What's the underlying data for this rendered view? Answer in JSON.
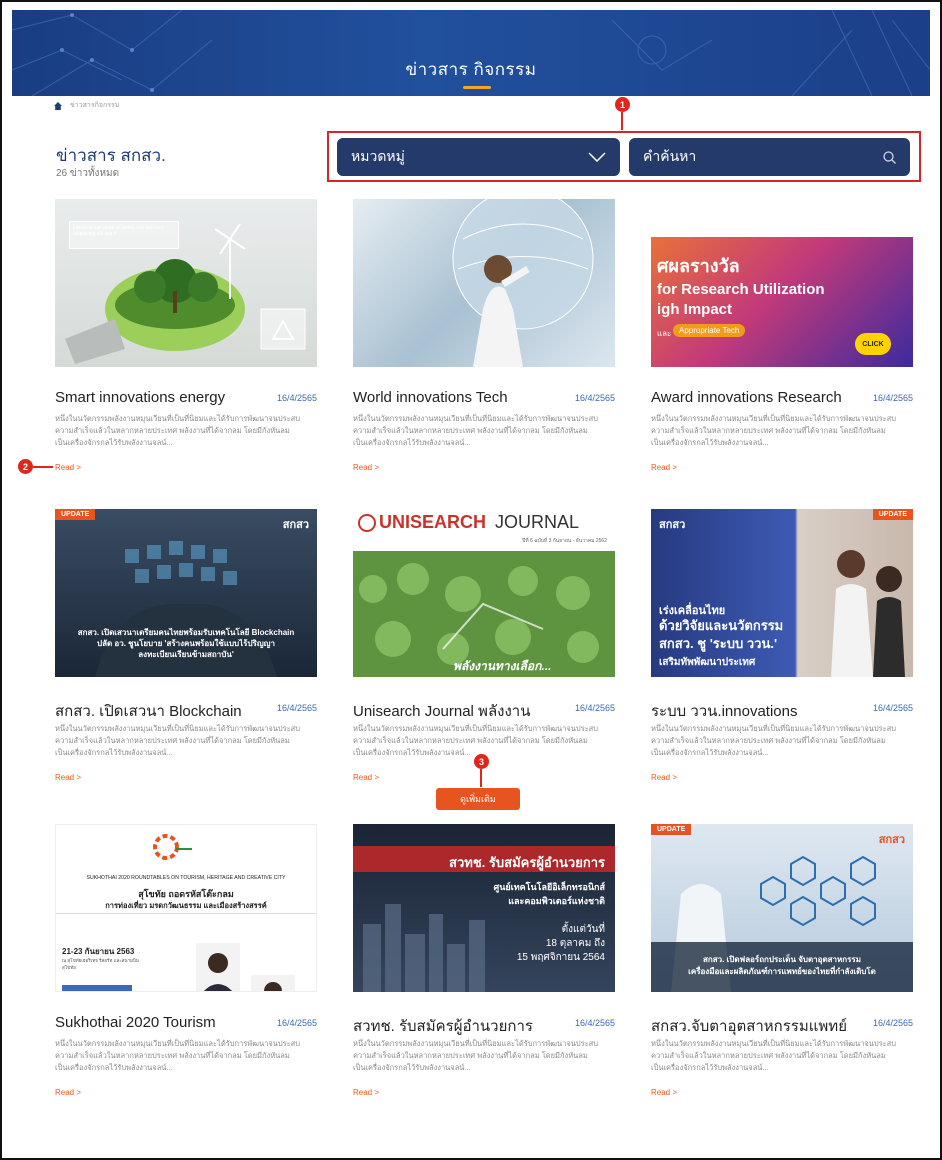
{
  "header": {
    "title": "ข่าวสาร กิจกรรม"
  },
  "breadcrumb": {
    "current": "ข่าวสารกิจกรรม"
  },
  "list": {
    "title": "ข่าวสาร สกสว.",
    "count": "26 ข่าวทั้งหมด"
  },
  "filters": {
    "category_label": "หมวดหมู่",
    "search_placeholder": "คำค้นหา"
  },
  "markers": {
    "m1": "1",
    "m2": "2",
    "m3": "3"
  },
  "cards": [
    {
      "title": "Smart innovations energy",
      "date": "16/4/2565",
      "desc1": "หนึ่งในนวัตกรรมพลังงานหมุนเวียนที่เป็นที่นิยมและได้รับการพัฒนาจนประสบ",
      "desc2": "ความสำเร็จแล้วในหลากหลายประเทศ พลังงานที่ได้จากลม โดยมีกังหันลม",
      "desc3": "เป็นเครื่องจักรกลไว้รับพลังงานจลน์...",
      "read": "Read >",
      "thumb_text": "Lorem ipsum dolor sit amet, con sectetur adipiscing elit sed d"
    },
    {
      "title": "World innovations Tech",
      "date": "16/4/2565",
      "desc1": "หนึ่งในนวัตกรรมพลังงานหมุนเวียนที่เป็นที่นิยมและได้รับการพัฒนาจนประสบ",
      "desc2": "ความสำเร็จแล้วในหลากหลายประเทศ พลังงานที่ได้จากลม โดยมีกังหันลม",
      "desc3": "เป็นเครื่องจักรกลไว้รับพลังงานจลน์...",
      "read": "Read >"
    },
    {
      "title": "Award innovations Research",
      "date": "16/4/2565",
      "desc1": "หนึ่งในนวัตกรรมพลังงานหมุนเวียนที่เป็นที่นิยมและได้รับการพัฒนาจนประสบ",
      "desc2": "ความสำเร็จแล้วในหลากหลายประเทศ พลังงานที่ได้จากลม โดยมีกังหันลม",
      "desc3": "เป็นเครื่องจักรกลไว้รับพลังงานจลน์...",
      "read": "Read >",
      "thumb_l1": "ศผลรางวัล",
      "thumb_l2": "for Research Utilization",
      "thumb_l3": "igh Impact",
      "thumb_l4": "และ",
      "thumb_pill": "Appropriate Tech",
      "thumb_click": "CLICK"
    },
    {
      "title": "สกสว. เปิดเสวนา Blockchain",
      "date": "16/4/2565",
      "desc1": "หนึ่งในนวัตกรรมพลังงานหมุนเวียนที่เป็นที่นิยมและได้รับการพัฒนาจนประสบ",
      "desc2": "ความสำเร็จแล้วในหลากหลายประเทศ พลังงานที่ได้จากลม โดยมีกังหันลม",
      "desc3": "เป็นเครื่องจักรกลไว้รับพลังงานจลน์...",
      "read": "Read >",
      "badge": "UPDATE",
      "logo": "สกสว",
      "thumb_l1": "สกสว. เปิดเสวนาเตรียมคนไทยพร้อมรับเทคโนโลยี Blockchain",
      "thumb_l2": "ปลัด อว. ชูนโยบาย 'สร้างคนพร้อมใช้แบบไร้ปริญญา",
      "thumb_l3": "ลงทะเบียนเรียนข้ามสถาบัน'"
    },
    {
      "title": "Unisearch Journal พลังงาน",
      "date": "16/4/2565",
      "desc1": "หนึ่งในนวัตกรรมพลังงานหมุนเวียนที่เป็นที่นิยมและได้รับการพัฒนาจนประสบ",
      "desc2": "ความสำเร็จแล้วในหลากหลายประเทศ พลังงานที่ได้จากลม โดยมีกังหันลม",
      "desc3": "เป็นเครื่องจักรกลไว้รับพลังงานจลน์...",
      "read": "Read >",
      "thumb_l1": "UNISEARCH",
      "thumb_l2": "JOURNAL",
      "thumb_l3": "ปีที่ 6 ฉบับที่ 3 กันยายน - ธันวาคม 2562",
      "thumb_l4": "พลังงานทางเลือก..."
    },
    {
      "title": "ระบบ ววน.innovations",
      "date": "16/4/2565",
      "desc1": "หนึ่งในนวัตกรรมพลังงานหมุนเวียนที่เป็นที่นิยมและได้รับการพัฒนาจนประสบ",
      "desc2": "ความสำเร็จแล้วในหลากหลายประเทศ พลังงานที่ได้จากลม โดยมีกังหันลม",
      "desc3": "เป็นเครื่องจักรกลไว้รับพลังงานจลน์...",
      "read": "Read >",
      "badge": "UPDATE",
      "logo": "สกสว",
      "thumb_l1": "เร่งเคลื่อนไทย",
      "thumb_l2": "ด้วยวิจัยและนวัตกรรม",
      "thumb_l3": "สกสว. ชู 'ระบบ ววน.'",
      "thumb_l4": "เสริมทัพพัฒนาประเทศ"
    },
    {
      "title": "Sukhothai 2020 Tourism",
      "date": "16/4/2565",
      "desc1": "หนึ่งในนวัตกรรมพลังงานหมุนเวียนที่เป็นที่นิยมและได้รับการพัฒนาจนประสบ",
      "desc2": "ความสำเร็จแล้วในหลากหลายประเทศ พลังงานที่ได้จากลม โดยมีกังหันลม",
      "desc3": "เป็นเครื่องจักรกลไว้รับพลังงานจลน์...",
      "read": "Read >",
      "thumb_l1": "SUKHOTHAI 2020 ROUNDTABLES ON TOURISM, HERITAGE AND CREATIVE CITY",
      "thumb_l2": "สุโขทัย ถอดรหัสโต๊ะกลม",
      "thumb_l3": "การท่องเที่ยว มรดกวัฒนธรรม และเมืองสร้างสรรค์",
      "thumb_l4": "21-23 กันยายน 2563",
      "thumb_l5": "ณ สุโขทัยเฮอริเทจ รีสอร์ท และสนามบินสุโขทัย"
    },
    {
      "title": "สวทช. รับสมัครผู้อำนวยการ",
      "date": "16/4/2565",
      "desc1": "หนึ่งในนวัตกรรมพลังงานหมุนเวียนที่เป็นที่นิยมและได้รับการพัฒนาจนประสบ",
      "desc2": "ความสำเร็จแล้วในหลากหลายประเทศ พลังงานที่ได้จากลม โดยมีกังหันลม",
      "desc3": "เป็นเครื่องจักรกลไว้รับพลังงานจลน์...",
      "read": "Read >",
      "thumb_l1": "สวทช. รับสมัครผู้อำนวยการ",
      "thumb_l2": "ศูนย์เทคโนโลยีอิเล็กทรอนิกส์",
      "thumb_l3": "และคอมพิวเตอร์แห่งชาติ",
      "thumb_l4": "ตั้งแต่วันที่",
      "thumb_l5": "18 ตุลาคม ถึง",
      "thumb_l6": "15 พฤศจิกายน 2564"
    },
    {
      "title": "สกสว.จับตาอุตสาหกรรมแพทย์",
      "date": "16/4/2565",
      "desc1": "หนึ่งในนวัตกรรมพลังงานหมุนเวียนที่เป็นที่นิยมและได้รับการพัฒนาจนประสบ",
      "desc2": "ความสำเร็จแล้วในหลากหลายประเทศ พลังงานที่ได้จากลม โดยมีกังหันลม",
      "desc3": "เป็นเครื่องจักรกลไว้รับพลังงานจลน์...",
      "read": "Read >",
      "badge": "UPDATE",
      "logo": "สกสว",
      "thumb_l1": "สกสว. เปิดฟลอร์ถกประเด็น จับตาอุตสาหกรรม",
      "thumb_l2": "เครื่องมือและผลิตภัณฑ์การแพทย์ของไทยที่กำลังเติบโต"
    }
  ],
  "more_button": "ดูเพิ่มเติม"
}
